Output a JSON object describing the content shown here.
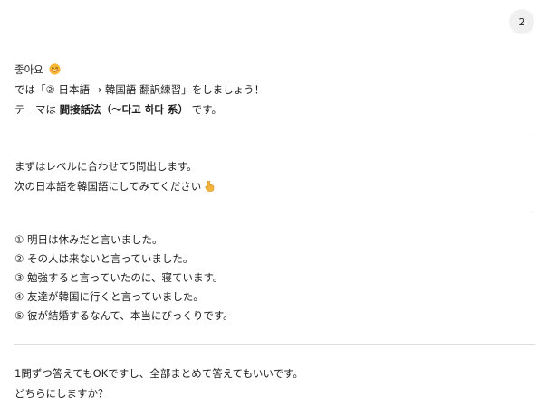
{
  "user_message": {
    "text": "2"
  },
  "intro": {
    "greeting": "좋아요",
    "line2": "では「② 日本語 → 韓国語 翻訳練習」をしましょう！",
    "line3_prefix": "テーマは ",
    "line3_bold": "間接話法（〜다고 하다 系）",
    "line3_suffix": " です。"
  },
  "instructions": {
    "line1": "まずはレベルに合わせて5問出します。",
    "line2": "次の日本語を韓国語にしてみてください"
  },
  "questions": [
    "① 明日は休みだと言いました。",
    "② その人は来ないと言っていました。",
    "③ 勉強すると言っていたのに、寝ています。",
    "④ 友達が韓国に行くと言っていました。",
    "⑤ 彼が結婚するなんて、本当にびっくりです。"
  ],
  "closing": {
    "line1": "1問ずつ答えてもOKですし、全部まとめて答えてもいいです。",
    "line2": "どちらにしますか？"
  },
  "icons": {
    "smile": "smiling-face-icon",
    "pointing": "backhand-index-pointing-down-icon"
  },
  "colors": {
    "bubble_bg": "#f0f0f0",
    "divider": "#dedede",
    "emoji_face": "#f7b733",
    "emoji_hand": "#f5b43c"
  }
}
